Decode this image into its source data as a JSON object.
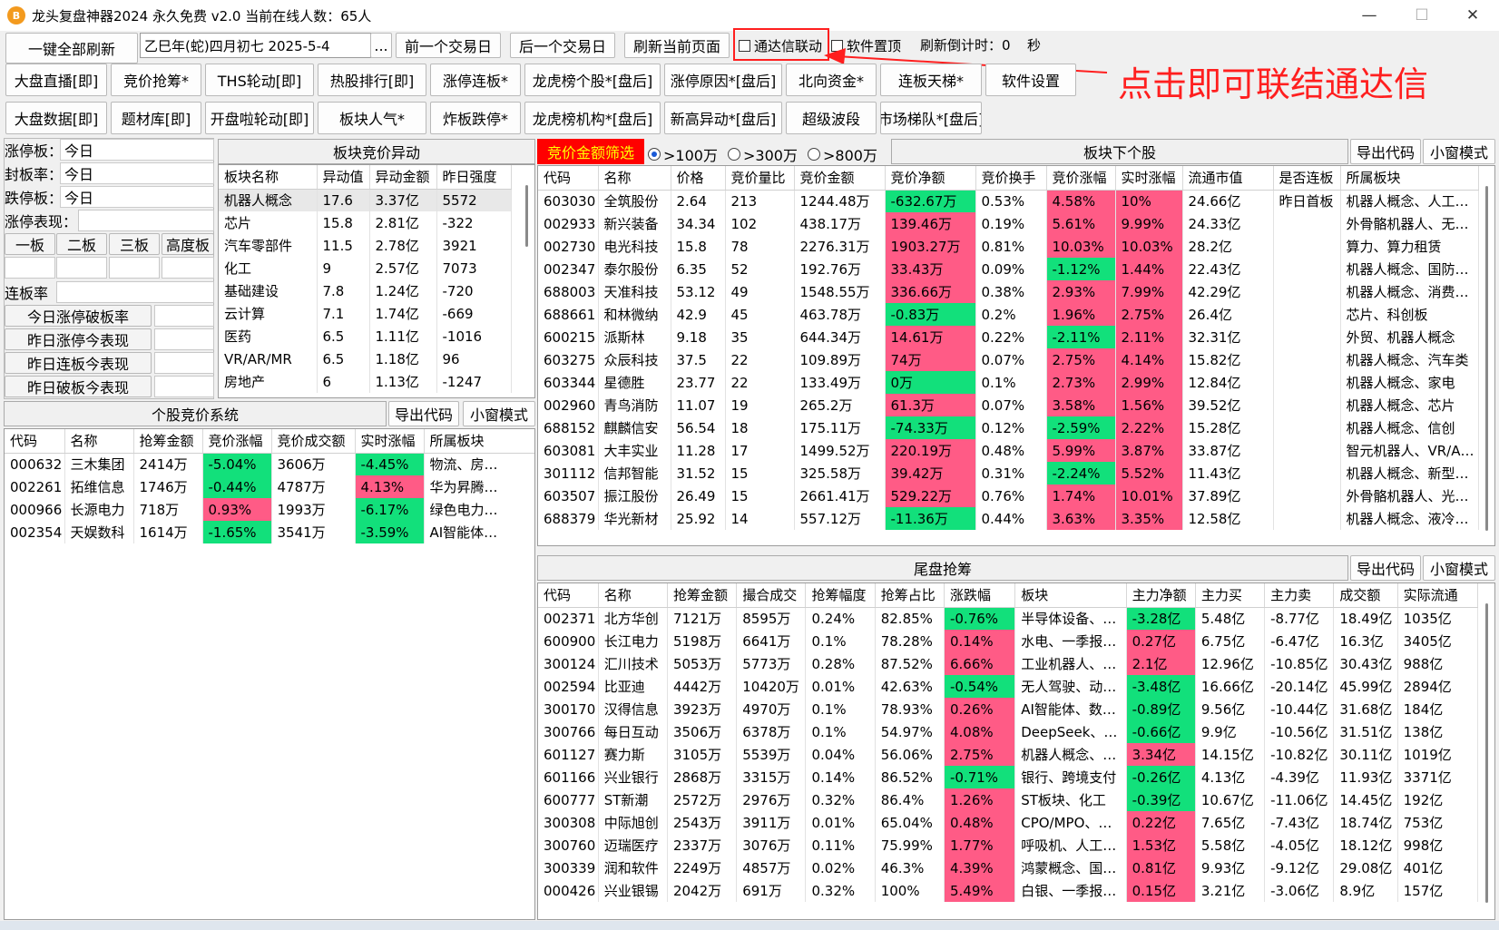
{
  "window": {
    "icon_text": "B",
    "title": "龙头复盘神器2024 永久免费 v2.0 当前在线人数：65人",
    "minimize": "—",
    "maximize": "☐",
    "close": "✕"
  },
  "toolbar": {
    "refresh_all": "一键全部刷新",
    "date_value": "乙巳年(蛇)四月初七  2025-5-4",
    "date_picker": "...",
    "prev_day": "前一个交易日",
    "next_day": "后一个交易日",
    "refresh_page": "刷新当前页面",
    "tdx_link": "通达信联动",
    "pin_top": "软件置顶",
    "countdown_label": "刷新倒计时：0",
    "countdown_unit": "秒"
  },
  "nav_row1": [
    "大盘直播[即]",
    "竞价抢筹*",
    "THS轮动[即]",
    "热股排行[即]",
    "涨停连板*",
    "龙虎榜个股*[盘后]",
    "涨停原因*[盘后]",
    "北向资金*",
    "连板天梯*",
    "软件设置"
  ],
  "nav_row2": [
    "大盘数据[即]",
    "题材库[即]",
    "开盘啦轮动[即]",
    "板块人气*",
    "炸板跌停*",
    "龙虎榜机构*[盘后]",
    "新高异动*[盘后]",
    "超级波段",
    "市场梯队*[盘后]"
  ],
  "annotation": "点击即可联结通达信",
  "left_stats": {
    "limit_up_label": "涨停板：",
    "limit_up_value": "今日",
    "seal_rate_label": "封板率：",
    "seal_rate_value": "今日",
    "limit_down_label": "跌停板：",
    "limit_down_value": "今日",
    "limit_perf_label": "涨停表现：",
    "boards": [
      "一板",
      "二板",
      "三板",
      "高度板"
    ],
    "chain_label": "连板率",
    "perf_buttons": [
      "今日涨停破板率",
      "昨日涨停今表现",
      "昨日连板今表现",
      "昨日破板今表现"
    ]
  },
  "sector_panel": {
    "title": "板块竞价异动",
    "headers": [
      "板块名称",
      "异动值",
      "异动金额",
      "昨日强度"
    ],
    "rows": [
      [
        "机器人概念",
        "17.6",
        "3.37亿",
        "5572"
      ],
      [
        "芯片",
        "15.8",
        "2.81亿",
        "-322"
      ],
      [
        "汽车零部件",
        "11.5",
        "2.78亿",
        "3921"
      ],
      [
        "化工",
        "9",
        "2.57亿",
        "7073"
      ],
      [
        "基础建设",
        "7.8",
        "1.24亿",
        "-720"
      ],
      [
        "云计算",
        "7.1",
        "1.74亿",
        "-669"
      ],
      [
        "医药",
        "6.5",
        "1.11亿",
        "-1016"
      ],
      [
        "VR/AR/MR",
        "6.5",
        "1.18亿",
        "96"
      ],
      [
        "房地产",
        "6",
        "1.13亿",
        "-1247"
      ]
    ]
  },
  "stock_auction_panel": {
    "title": "个股竞价系统",
    "export": "导出代码",
    "mini": "小窗模式",
    "headers": [
      "代码",
      "名称",
      "抢筹金额",
      "竞价涨幅",
      "竞价成交额",
      "实时涨幅",
      "所属板块"
    ],
    "rows": [
      [
        "000632",
        "三木集团",
        "2414万",
        "-5.04%",
        "3606万",
        "-4.45%",
        "物流、房…"
      ],
      [
        "002261",
        "拓维信息",
        "1746万",
        "-0.44%",
        "4787万",
        "4.13%",
        "华为昇腾…"
      ],
      [
        "000966",
        "长源电力",
        "718万",
        "0.93%",
        "1993万",
        "-6.17%",
        "绿色电力…"
      ],
      [
        "002354",
        "天娱数科",
        "1614万",
        "-1.65%",
        "3541万",
        "-3.59%",
        "AI智能体…"
      ]
    ]
  },
  "filter_bar": {
    "label": "竞价金额筛选",
    "options": [
      ">100万",
      ">300万",
      ">800万"
    ],
    "selected": 0
  },
  "sector_stock_panel": {
    "title": "板块下个股",
    "export": "导出代码",
    "mini": "小窗模式",
    "headers": [
      "代码",
      "名称",
      "价格",
      "竞价量比",
      "竞价金额",
      "竞价净额",
      "竞价换手",
      "竞价涨幅",
      "实时涨幅",
      "流通市值",
      "是否连板",
      "所属板块"
    ],
    "rows": [
      [
        "603030",
        "全筑股份",
        "2.64",
        "213",
        "1244.48万",
        "-632.67万",
        "0.53%",
        "4.58%",
        "10%",
        "24.66亿",
        "昨日首板",
        "机器人概念、人工…"
      ],
      [
        "002933",
        "新兴装备",
        "34.34",
        "102",
        "438.17万",
        "139.46万",
        "0.19%",
        "5.61%",
        "9.99%",
        "24.33亿",
        "",
        "外骨骼机器人、无…"
      ],
      [
        "002730",
        "电光科技",
        "15.8",
        "78",
        "2276.31万",
        "1903.27万",
        "0.81%",
        "10.03%",
        "10.03%",
        "28.2亿",
        "",
        "算力、算力租赁"
      ],
      [
        "002347",
        "泰尔股份",
        "6.35",
        "52",
        "192.76万",
        "33.43万",
        "0.09%",
        "-1.12%",
        "1.44%",
        "22.43亿",
        "",
        "机器人概念、国防…"
      ],
      [
        "688003",
        "天准科技",
        "53.12",
        "49",
        "1548.55万",
        "336.66万",
        "0.38%",
        "2.93%",
        "7.99%",
        "42.29亿",
        "",
        "机器人概念、消费…"
      ],
      [
        "688661",
        "和林微纳",
        "42.9",
        "45",
        "463.78万",
        "-0.83万",
        "0.2%",
        "1.96%",
        "2.75%",
        "26.4亿",
        "",
        "芯片、科创板"
      ],
      [
        "600215",
        "派斯林",
        "9.18",
        "35",
        "644.34万",
        "14.61万",
        "0.22%",
        "-2.11%",
        "2.11%",
        "32.31亿",
        "",
        "外贸、机器人概念"
      ],
      [
        "603275",
        "众辰科技",
        "37.5",
        "22",
        "109.89万",
        "74万",
        "0.07%",
        "2.75%",
        "4.14%",
        "15.82亿",
        "",
        "机器人概念、汽车类"
      ],
      [
        "603344",
        "星德胜",
        "23.77",
        "22",
        "133.49万",
        "0万",
        "0.1%",
        "2.73%",
        "2.99%",
        "12.84亿",
        "",
        "机器人概念、家电"
      ],
      [
        "002960",
        "青鸟消防",
        "11.07",
        "19",
        "265.2万",
        "61.3万",
        "0.07%",
        "3.58%",
        "1.56%",
        "39.52亿",
        "",
        "机器人概念、芯片"
      ],
      [
        "688152",
        "麒麟信安",
        "56.54",
        "18",
        "175.11万",
        "-74.33万",
        "0.12%",
        "-2.59%",
        "2.22%",
        "15.28亿",
        "",
        "机器人概念、信创"
      ],
      [
        "603081",
        "大丰实业",
        "11.28",
        "17",
        "1499.52万",
        "220.19万",
        "0.48%",
        "5.99%",
        "3.87%",
        "33.87亿",
        "",
        "智元机器人、VR/A…"
      ],
      [
        "301112",
        "信邦智能",
        "31.52",
        "15",
        "325.58万",
        "39.42万",
        "0.31%",
        "-2.24%",
        "5.52%",
        "11.43亿",
        "",
        "机器人概念、新型…"
      ],
      [
        "603507",
        "振江股份",
        "26.49",
        "15",
        "2661.41万",
        "529.22万",
        "0.76%",
        "1.74%",
        "10.01%",
        "37.89亿",
        "",
        "外骨骼机器人、光…"
      ],
      [
        "688379",
        "华光新材",
        "25.92",
        "14",
        "557.12万",
        "-11.36万",
        "0.44%",
        "3.63%",
        "3.35%",
        "12.58亿",
        "",
        "机器人概念、液冷…"
      ]
    ]
  },
  "tail_panel": {
    "title": "尾盘抢筹",
    "export": "导出代码",
    "mini": "小窗模式",
    "headers": [
      "代码",
      "名称",
      "抢筹金额",
      "撮合成交",
      "抢筹幅度",
      "抢筹占比",
      "涨跌幅",
      "板块",
      "主力净额",
      "主力买",
      "主力卖",
      "成交额",
      "实际流通"
    ],
    "rows": [
      [
        "002371",
        "北方华创",
        "7121万",
        "8595万",
        "0.24%",
        "82.85%",
        "-0.76%",
        "半导体设备、…",
        "-3.28亿",
        "5.48亿",
        "-8.77亿",
        "18.49亿",
        "1035亿"
      ],
      [
        "600900",
        "长江电力",
        "5198万",
        "6641万",
        "0.1%",
        "78.28%",
        "0.14%",
        "水电、一季报…",
        "0.27亿",
        "6.75亿",
        "-6.47亿",
        "16.3亿",
        "3405亿"
      ],
      [
        "300124",
        "汇川技术",
        "5053万",
        "5773万",
        "0.28%",
        "87.52%",
        "6.66%",
        "工业机器人、…",
        "2.1亿",
        "12.96亿",
        "-10.85亿",
        "30.43亿",
        "988亿"
      ],
      [
        "002594",
        "比亚迪",
        "4442万",
        "10420万",
        "0.01%",
        "42.63%",
        "-0.54%",
        "无人驾驶、动…",
        "-3.48亿",
        "16.66亿",
        "-20.14亿",
        "45.99亿",
        "2894亿"
      ],
      [
        "300170",
        "汉得信息",
        "3923万",
        "4970万",
        "0.1%",
        "78.93%",
        "0.26%",
        "AI智能体、数…",
        "-0.89亿",
        "9.56亿",
        "-10.44亿",
        "31.68亿",
        "184亿"
      ],
      [
        "300766",
        "每日互动",
        "3506万",
        "6378万",
        "0.1%",
        "54.97%",
        "4.08%",
        "DeepSeek、…",
        "-0.66亿",
        "9.9亿",
        "-10.56亿",
        "31.51亿",
        "138亿"
      ],
      [
        "601127",
        "赛力斯",
        "3105万",
        "5539万",
        "0.04%",
        "56.06%",
        "2.75%",
        "机器人概念、…",
        "3.34亿",
        "14.15亿",
        "-10.82亿",
        "30.11亿",
        "1019亿"
      ],
      [
        "601166",
        "兴业银行",
        "2868万",
        "3315万",
        "0.14%",
        "86.52%",
        "-0.71%",
        "银行、跨境支付",
        "-0.26亿",
        "4.13亿",
        "-4.39亿",
        "11.93亿",
        "3371亿"
      ],
      [
        "600777",
        "ST新潮",
        "2572万",
        "2976万",
        "0.32%",
        "86.4%",
        "1.26%",
        "ST板块、化工",
        "-0.39亿",
        "10.67亿",
        "-11.06亿",
        "14.45亿",
        "192亿"
      ],
      [
        "300308",
        "中际旭创",
        "2543万",
        "3911万",
        "0.01%",
        "65.04%",
        "0.48%",
        "CPO/MPO、…",
        "0.22亿",
        "7.65亿",
        "-7.43亿",
        "18.74亿",
        "753亿"
      ],
      [
        "300760",
        "迈瑞医疗",
        "2337万",
        "3076万",
        "0.11%",
        "75.99%",
        "1.77%",
        "呼吸机、人工…",
        "1.53亿",
        "5.58亿",
        "-4.05亿",
        "18.12亿",
        "998亿"
      ],
      [
        "300339",
        "润和软件",
        "2249万",
        "4857万",
        "0.02%",
        "46.3%",
        "4.39%",
        "鸿蒙概念、国…",
        "0.81亿",
        "9.93亿",
        "-9.12亿",
        "29.08亿",
        "401亿"
      ],
      [
        "000426",
        "兴业银锡",
        "2042万",
        "691万",
        "0.32%",
        "100%",
        "5.49%",
        "白银、一季报…",
        "0.15亿",
        "3.21亿",
        "-3.06亿",
        "8.9亿",
        "157亿"
      ]
    ]
  },
  "colors": {
    "up": "#ff5b86",
    "down": "#12e07b",
    "annotation": "#ff1f1f",
    "filter_bg": "#ff0000",
    "filter_text": "#ffff00"
  }
}
